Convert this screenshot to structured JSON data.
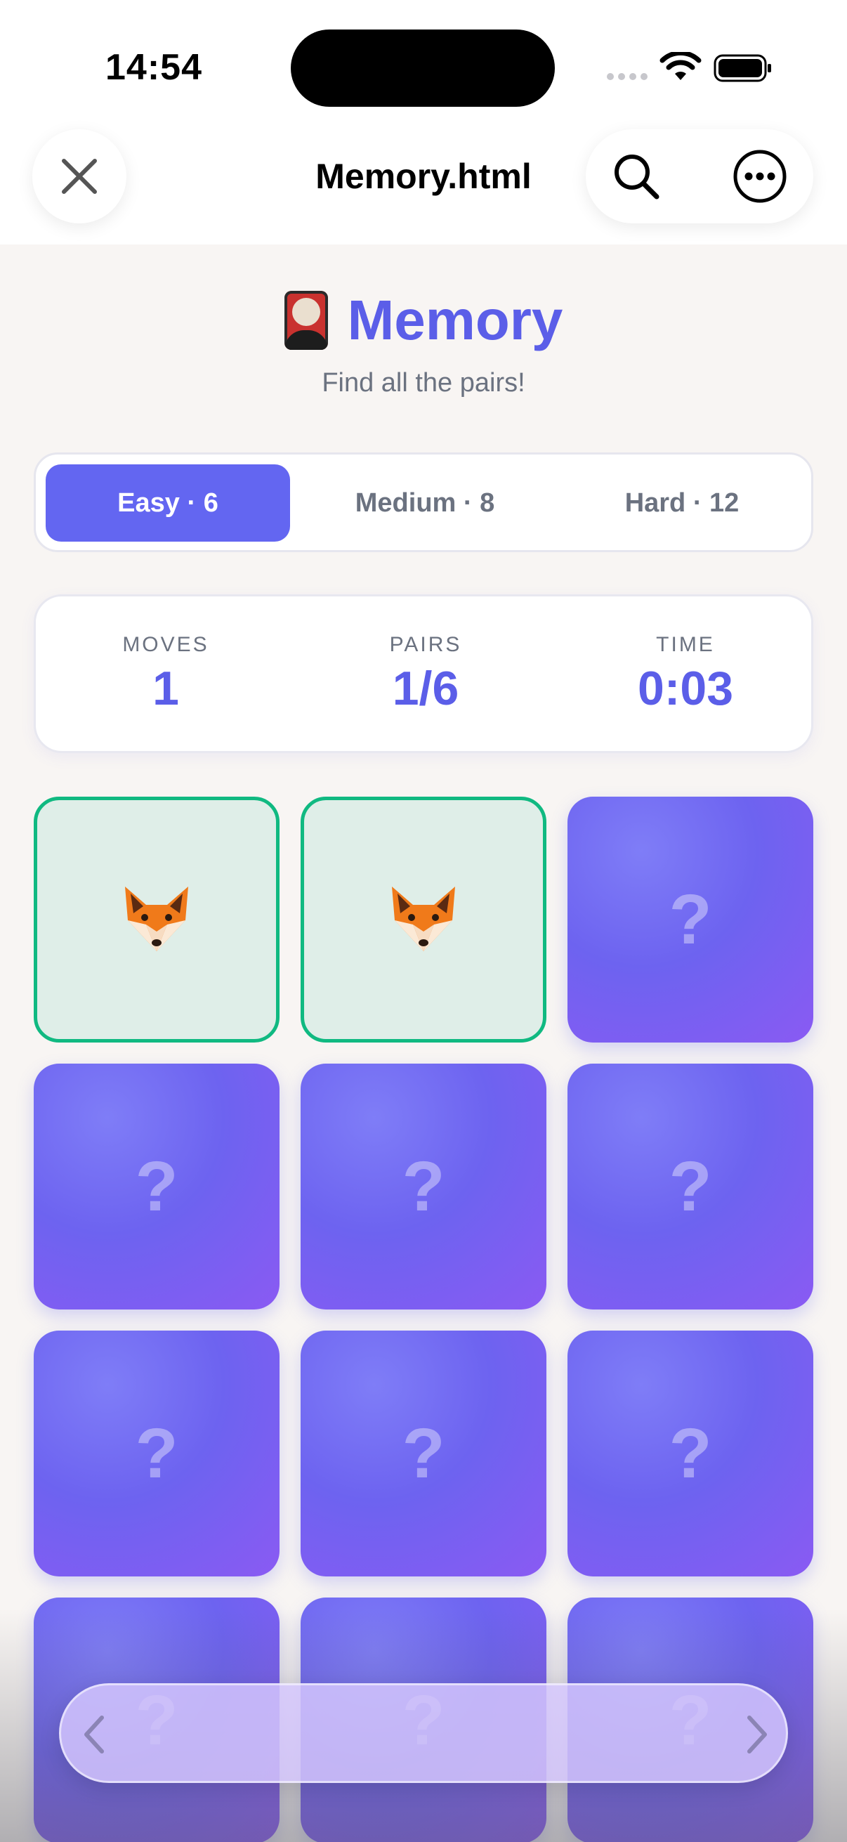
{
  "status": {
    "time": "14:54"
  },
  "browser": {
    "title": "Memory.html"
  },
  "game": {
    "title": "Memory",
    "subtitle": "Find all the pairs!",
    "difficulties": [
      {
        "label": "Easy · 6",
        "active": true
      },
      {
        "label": "Medium · 8",
        "active": false
      },
      {
        "label": "Hard · 12",
        "active": false
      }
    ],
    "stats": [
      {
        "label": "MOVES",
        "value": "1"
      },
      {
        "label": "PAIRS",
        "value": "1/6"
      },
      {
        "label": "TIME",
        "value": "0:03"
      }
    ],
    "hidden_symbol": "?",
    "tiles": [
      {
        "state": "matched",
        "icon": "fox-icon"
      },
      {
        "state": "matched",
        "icon": "fox-icon"
      },
      {
        "state": "hidden"
      },
      {
        "state": "hidden"
      },
      {
        "state": "hidden"
      },
      {
        "state": "hidden"
      },
      {
        "state": "hidden"
      },
      {
        "state": "hidden"
      },
      {
        "state": "hidden"
      },
      {
        "state": "hidden"
      },
      {
        "state": "hidden"
      },
      {
        "state": "hidden"
      }
    ]
  },
  "toolbar": {
    "back_icon": "chevron-left-icon",
    "forward_icon": "chevron-right-icon"
  },
  "colors": {
    "accent": "#6366f1",
    "matched_border": "#10b981",
    "matched_bg": "#dfeee8"
  }
}
